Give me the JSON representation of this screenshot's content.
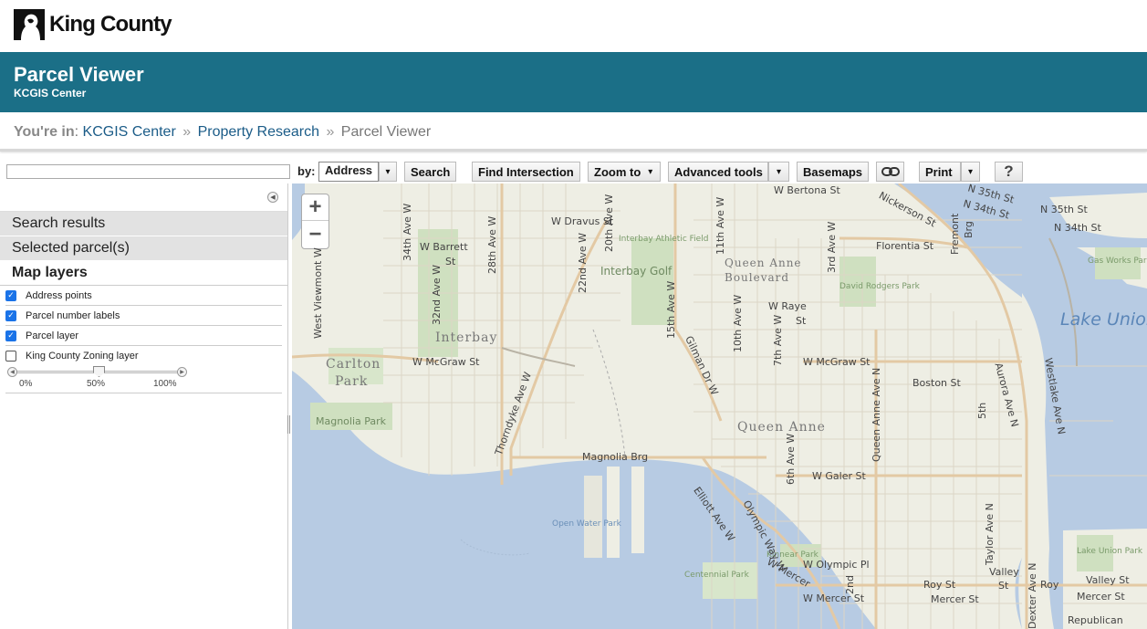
{
  "logo": {
    "text": "King County",
    "icon": "king-county-logo-icon"
  },
  "banner": {
    "title": "Parcel Viewer",
    "subtitle": "KCGIS Center"
  },
  "breadcrumb": {
    "label": "You're in",
    "items": [
      "KCGIS Center",
      "Property Research",
      "Parcel Viewer"
    ],
    "separator": "»"
  },
  "toolbar": {
    "search_value": "",
    "by_label": "by:",
    "by_selected": "Address",
    "search": "Search",
    "find_intersection": "Find Intersection",
    "zoom_to": "Zoom to",
    "advanced_tools": "Advanced tools",
    "basemaps": "Basemaps",
    "print": "Print",
    "help": "?",
    "caret": "▾",
    "link_icon": "link-icon"
  },
  "panel": {
    "collapse_icon": "◀",
    "sections": [
      "Search results",
      "Selected parcel(s)",
      "Map layers"
    ],
    "layers": [
      {
        "label": "Address points",
        "checked": true
      },
      {
        "label": "Parcel number labels",
        "checked": true
      },
      {
        "label": "Parcel layer",
        "checked": true
      },
      {
        "label": "King County Zoning layer",
        "checked": false
      }
    ],
    "slider": {
      "value": 0.5,
      "ticks": [
        "0%",
        "50%",
        "100%"
      ],
      "left_icon": "◀",
      "right_icon": "▶"
    },
    "check_glyph": "✓"
  },
  "map": {
    "zoom_in": "+",
    "zoom_out": "−",
    "labels": {
      "w_bertona": "W Bertona St",
      "n35th": "N 35th St",
      "n35th_b": "N 35th St",
      "n34th": "N 34th St",
      "n34th_b": "N 34th St",
      "nickerson": "Nickerson St",
      "w_dravus": "W Dravus St",
      "w_barrett": "W Barrett",
      "st": "St",
      "florentia": "Florentia St",
      "fremont": "Fremont",
      "brg": "Brg",
      "interbay_golf": "Interbay Golf",
      "interbay_athletic": "Interbay Athletic Field",
      "queen_anne_blvd_1": "Queen Anne",
      "queen_anne_blvd_2": "Boulevard",
      "gas_works": "Gas Works Park",
      "lake_union": "Lake Union",
      "david_rodgers": "David Rodgers Park",
      "w_raye": "W Raye",
      "raye_st": "St",
      "queen_anne_ave": "Queen Anne Ave N",
      "interbay": "Interbay",
      "carlton_1": "Carlton",
      "carlton_2": "Park",
      "w_mcgraw": "W McGraw St",
      "w_mcgraw_b": "W McGraw St",
      "boston": "Boston St",
      "magnolia_park": "Magnolia Park",
      "queen_anne": "Queen Anne",
      "magnolia_brg": "Magnolia Brg",
      "w_galer": "W Galer St",
      "open_water": "Open Water Park",
      "kinnear": "Kinnear Park",
      "w_olympic": "W Olympic Pl",
      "centennial": "Centennial Park",
      "w_mercer": "W Mercer",
      "w_mercer_b": "W Mercer St",
      "roy": "Roy St",
      "roy_b": "Roy",
      "mercer": "Mercer St",
      "mercer_b": "Mercer St",
      "republican": "Republican",
      "lake_union_park": "Lake Union Park",
      "valley": "Valley",
      "valley_st": "St",
      "valley_st_b": "Valley St",
      "w_viewmont": "West Viewmont W",
      "ave34": "34th Ave W",
      "ave32": "32nd Ave W",
      "ave28": "28th Ave W",
      "ave22": "22nd Ave W",
      "ave20": "20th Ave W",
      "ave15": "15th Ave W",
      "ave11": "11th Ave W",
      "ave10": "10th Ave W",
      "ave7": "7th Ave W",
      "ave3": "3rd Ave W",
      "ave6": "6th Ave W",
      "ave5": "5th",
      "ave2": "2nd",
      "thorndyke": "Thorndyke Ave W",
      "aurora": "Aurora Ave N",
      "westlake": "Westlake Ave N",
      "dexter": "Dexter Ave N",
      "taylor": "Taylor Ave N",
      "elliott": "Elliott Ave W",
      "gilman": "Gilman Dr W",
      "olympic_way": "Olympic Way W"
    }
  }
}
